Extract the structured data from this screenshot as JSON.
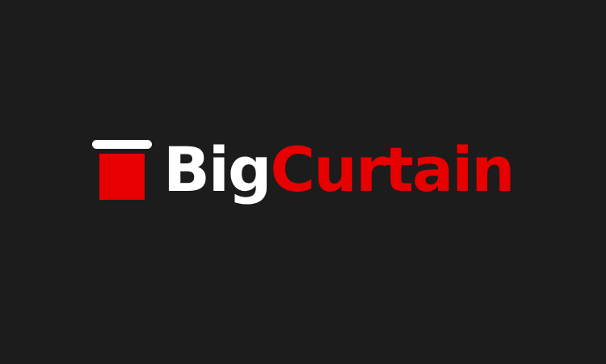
{
  "logo": {
    "icon": "curtain-icon",
    "word_big": "Big",
    "word_curtain": "Curtain"
  },
  "colors": {
    "background": "#1c1c1c",
    "white": "#ffffff",
    "red": "#e60000"
  }
}
